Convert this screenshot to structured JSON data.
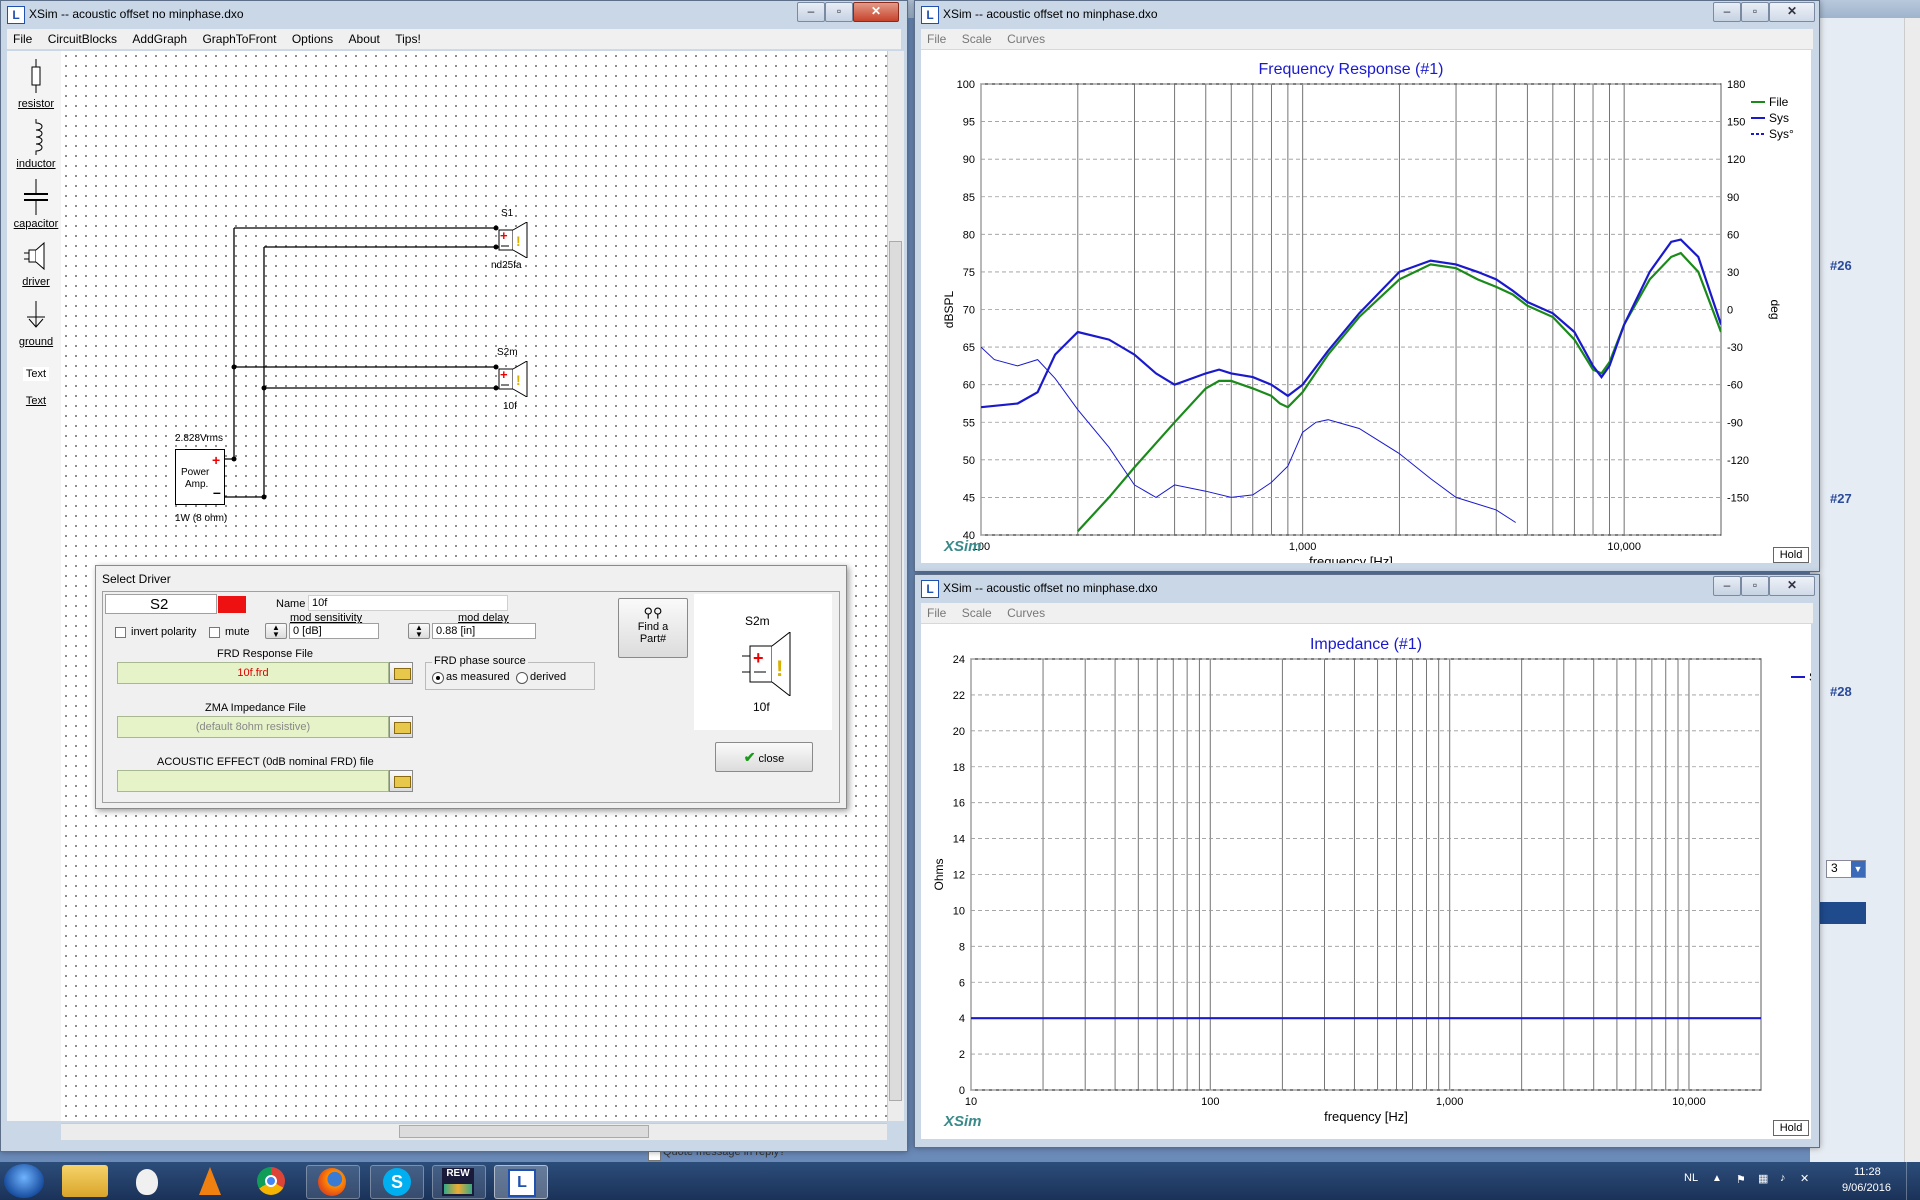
{
  "left_window": {
    "title": "XSim -- acoustic offset no minphase.dxo",
    "menu": [
      "File",
      "CircuitBlocks",
      "AddGraph",
      "GraphToFront",
      "Options",
      "About",
      "Tips!"
    ],
    "tools": [
      "resistor",
      "inductor",
      "capacitor",
      "driver",
      "ground",
      "Text",
      "Text"
    ]
  },
  "schematic": {
    "s1": {
      "name": "S1",
      "part": "nd25fa"
    },
    "s2m": {
      "name": "S2m",
      "part": "10f"
    },
    "amp": {
      "voltage": "2.828Vrms",
      "label_line1": "Power",
      "label_line2": "Amp.",
      "power": "1W (8 ohm)"
    }
  },
  "dialog": {
    "title": "Select Driver",
    "driver_id": "S2",
    "name_label": "Name",
    "name_value": "10f",
    "invert_polarity": "invert polarity",
    "mute": "mute",
    "mod_sensitivity_label": "mod sensitivity",
    "mod_sensitivity_value": "0 [dB]",
    "mod_delay_label": "mod delay",
    "mod_delay_value": "0.88 [in]",
    "find_part_line1": "Find a",
    "find_part_line2": "Part#",
    "frd_label": "FRD Response File",
    "frd_value": "10f.frd",
    "frd_phase_label": "FRD phase source",
    "phase_as_measured": "as measured",
    "phase_derived": "derived",
    "zma_label": "ZMA Impedance File",
    "zma_value": "(default 8ohm resistive)",
    "acoustic_label": "ACOUSTIC EFFECT (0dB nominal FRD) file",
    "acoustic_value": "",
    "preview_name": "S2m",
    "preview_part": "10f",
    "close_label": "close"
  },
  "freq_window": {
    "title": "XSim -- acoustic offset no minphase.dxo",
    "menu": [
      "File",
      "Scale",
      "Curves"
    ],
    "brand": "XSim",
    "hold": "Hold"
  },
  "imp_window": {
    "title": "XSim -- acoustic offset no minphase.dxo",
    "menu": [
      "File",
      "Scale",
      "Curves"
    ],
    "brand": "XSim",
    "hold": "Hold"
  },
  "chart_data": [
    {
      "type": "line",
      "title": "Frequency Response (#1)",
      "xlabel": "frequency [Hz]",
      "ylabel": "dBSPL",
      "y2label": "deg",
      "x_scale": "log",
      "xlim": [
        100,
        20000
      ],
      "ylim": [
        40,
        100
      ],
      "y2lim": [
        -180,
        180
      ],
      "x_tick_labels": [
        "100",
        "1,000",
        "10,000"
      ],
      "y_ticks": [
        40,
        45,
        50,
        55,
        60,
        65,
        70,
        75,
        80,
        85,
        90,
        95,
        100
      ],
      "y2_ticks": [
        -150,
        -120,
        -90,
        -60,
        -30,
        0,
        30,
        60,
        90,
        120,
        150,
        180
      ],
      "grid": true,
      "legend_position": "top-right",
      "series": [
        {
          "name": "File",
          "color": "#1a8a1a",
          "axis": "left",
          "points": [
            [
              200,
              40.5
            ],
            [
              250,
              45
            ],
            [
              300,
              49
            ],
            [
              400,
              55
            ],
            [
              500,
              59.5
            ],
            [
              550,
              60.5
            ],
            [
              600,
              60.5
            ],
            [
              700,
              59.5
            ],
            [
              800,
              58.5
            ],
            [
              850,
              57.5
            ],
            [
              900,
              57
            ],
            [
              1000,
              59
            ],
            [
              1200,
              64
            ],
            [
              1500,
              69
            ],
            [
              2000,
              74
            ],
            [
              2500,
              76
            ],
            [
              3000,
              75.5
            ],
            [
              3500,
              74
            ],
            [
              4000,
              73
            ],
            [
              4500,
              72
            ],
            [
              5000,
              70.5
            ],
            [
              6000,
              69
            ],
            [
              7000,
              66
            ],
            [
              8000,
              62
            ],
            [
              8500,
              61.5
            ],
            [
              9000,
              63
            ],
            [
              10000,
              68
            ],
            [
              12000,
              74
            ],
            [
              14000,
              77
            ],
            [
              15000,
              77.5
            ],
            [
              17000,
              75
            ],
            [
              20000,
              67
            ]
          ]
        },
        {
          "name": "Sys",
          "color": "#1a1acc",
          "axis": "left",
          "points": [
            [
              100,
              57
            ],
            [
              130,
              57.5
            ],
            [
              150,
              59
            ],
            [
              170,
              64
            ],
            [
              200,
              67
            ],
            [
              250,
              66
            ],
            [
              300,
              64
            ],
            [
              350,
              61.5
            ],
            [
              400,
              60
            ],
            [
              500,
              61.5
            ],
            [
              550,
              62
            ],
            [
              600,
              61.5
            ],
            [
              700,
              61
            ],
            [
              800,
              60
            ],
            [
              900,
              58.5
            ],
            [
              1000,
              60
            ],
            [
              1200,
              64.5
            ],
            [
              1500,
              69.5
            ],
            [
              2000,
              75
            ],
            [
              2500,
              76.5
            ],
            [
              3000,
              76
            ],
            [
              3500,
              75
            ],
            [
              4000,
              74
            ],
            [
              4500,
              72.5
            ],
            [
              5000,
              71
            ],
            [
              6000,
              69.5
            ],
            [
              7000,
              67
            ],
            [
              8000,
              62.5
            ],
            [
              8500,
              61
            ],
            [
              9000,
              62.5
            ],
            [
              10000,
              68
            ],
            [
              12000,
              75
            ],
            [
              14000,
              79
            ],
            [
              15000,
              79.3
            ],
            [
              17000,
              77
            ],
            [
              20000,
              68
            ]
          ]
        },
        {
          "name": "Sys°",
          "color": "#1a1acc",
          "dashed_legend": true,
          "axis": "right",
          "points": [
            [
              100,
              -30
            ],
            [
              110,
              -40
            ],
            [
              130,
              -45
            ],
            [
              150,
              -40
            ],
            [
              170,
              -55
            ],
            [
              200,
              -80
            ],
            [
              250,
              -110
            ],
            [
              300,
              -140
            ],
            [
              350,
              -150
            ],
            [
              400,
              -140
            ],
            [
              500,
              -145
            ],
            [
              600,
              -150
            ],
            [
              700,
              -148
            ],
            [
              800,
              -138
            ],
            [
              900,
              -125
            ],
            [
              1000,
              -98
            ],
            [
              1100,
              -90
            ],
            [
              1200,
              -88
            ],
            [
              1500,
              -95
            ],
            [
              2000,
              -115
            ],
            [
              2500,
              -135
            ],
            [
              3000,
              -150
            ],
            [
              4000,
              -160
            ],
            [
              4600,
              -170
            ]
          ]
        }
      ]
    },
    {
      "type": "line",
      "title": "Impedance (#1)",
      "xlabel": "frequency [Hz]",
      "ylabel": "Ohms",
      "x_scale": "log",
      "xlim": [
        10,
        20000
      ],
      "ylim": [
        0,
        24
      ],
      "x_tick_labels": [
        "10",
        "100",
        "1,000",
        "10,000"
      ],
      "y_ticks": [
        0,
        2,
        4,
        6,
        8,
        10,
        12,
        14,
        16,
        18,
        20,
        22,
        24
      ],
      "grid": true,
      "legend_position": "top-right",
      "series": [
        {
          "name": "Sys",
          "color": "#1a1acc",
          "points": [
            [
              10,
              4
            ],
            [
              20000,
              4
            ]
          ]
        }
      ]
    }
  ],
  "taskbar": {
    "language": "NL",
    "time": "11:28",
    "date": "9/06/2016",
    "rew_label": "REW"
  },
  "background": {
    "quote_message": "Quote message in reply?",
    "side_tags": [
      "#26",
      "#27",
      "#28"
    ],
    "side_number": "3"
  }
}
